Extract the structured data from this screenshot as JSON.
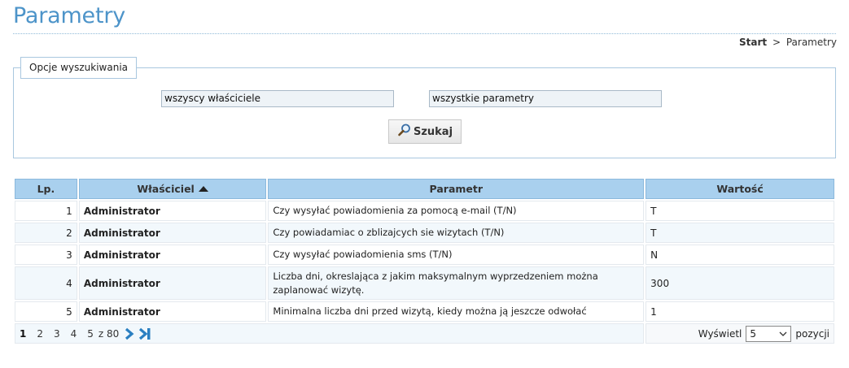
{
  "page": {
    "title": "Parametry",
    "breadcrumb": {
      "start": "Start",
      "separator": ">",
      "current": "Parametry"
    }
  },
  "search": {
    "legend": "Opcje wyszukiwania",
    "owner_select": "wszyscy właściciele",
    "param_select": "wszystkie parametry",
    "button_label": "Szukaj",
    "button_icon": "magnifier-icon"
  },
  "table": {
    "headers": {
      "lp": "Lp.",
      "owner": "Właściciel",
      "param": "Parametr",
      "value": "Wartość"
    },
    "sort_icon": "sort-asc-icon",
    "rows": [
      {
        "lp": "1",
        "owner": "Administrator",
        "param": "Czy wysyłać powiadomienia za pomocą e-mail (T/N)",
        "value": "T"
      },
      {
        "lp": "2",
        "owner": "Administrator",
        "param": "Czy powiadamiac o zblizajcych sie wizytach (T/N)",
        "value": "T"
      },
      {
        "lp": "3",
        "owner": "Administrator",
        "param": "Czy wysyłać powiadomienia sms (T/N)",
        "value": "N"
      },
      {
        "lp": "4",
        "owner": "Administrator",
        "param": "Liczba dni, okreslająca z jakim maksymalnym wyprzedzeniem można zaplanować wizytę.",
        "value": "300"
      },
      {
        "lp": "5",
        "owner": "Administrator",
        "param": "Minimalna liczba dni przed wizytą, kiedy można ją jeszcze odwołać",
        "value": "1"
      }
    ]
  },
  "pager": {
    "pages": [
      "1",
      "2",
      "3",
      "4",
      "5"
    ],
    "current": "1",
    "of_label": "z 80",
    "next_icon": "chevron-right-icon",
    "last_icon": "last-page-icon",
    "show_label": "Wyświetl",
    "per_page": "5",
    "items_label": "pozycji"
  },
  "colors": {
    "title": "#4d94c9",
    "header_bg": "#a9d0ee",
    "row_alt_bg": "#f2f8fc",
    "pager_icon": "#2a7fc1"
  }
}
